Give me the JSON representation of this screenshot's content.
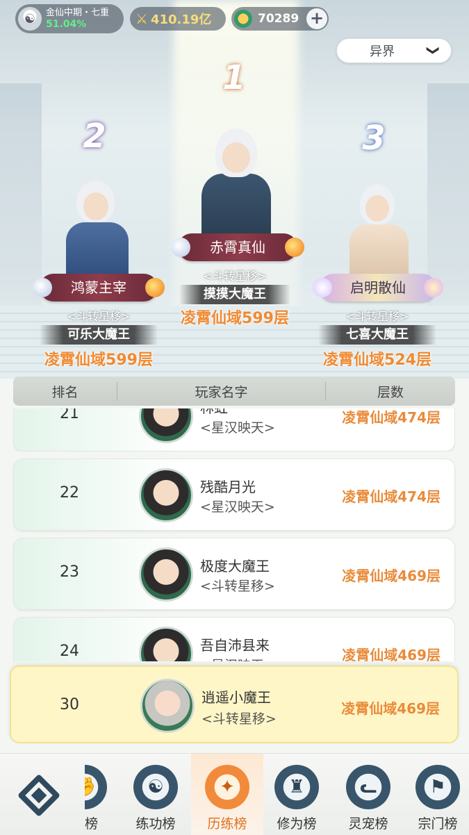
{
  "status": {
    "realm": "金仙中期・七重",
    "progress": "51.04%",
    "power": "410.19亿",
    "currency": "70289",
    "plus": "+"
  },
  "realm_select": {
    "value": "异界",
    "chevron": "❯"
  },
  "podium": [
    {
      "rank": "1",
      "name": "赤霄真仙",
      "sect": "<斗转星移>",
      "leader": "摸摸大魔王",
      "floor": "凌霄仙域599层"
    },
    {
      "rank": "2",
      "name": "鸿蒙主宰",
      "sect": "<斗转星移>",
      "leader": "可乐大魔王",
      "floor": "凌霄仙域599层"
    },
    {
      "rank": "3",
      "name": "启明散仙",
      "sect": "<斗转星移>",
      "leader": "七喜大魔王",
      "floor": "凌霄仙域524层"
    }
  ],
  "table_header": {
    "rank": "排名",
    "player": "玩家名字",
    "floor": "层数"
  },
  "rows": [
    {
      "rank": "21",
      "name": "林虹",
      "sect": "<星汉映天>",
      "floor": "凌霄仙域474层"
    },
    {
      "rank": "22",
      "name": "残酷月光",
      "sect": "<星汉映天>",
      "floor": "凌霄仙域474层"
    },
    {
      "rank": "23",
      "name": "极度大魔王",
      "sect": "<斗转星移>",
      "floor": "凌霄仙域469层"
    },
    {
      "rank": "24",
      "name": "吾自沛县来",
      "sect": "<星汉映天>",
      "floor": "凌霄仙域469层"
    }
  ],
  "self_row": {
    "rank": "30",
    "name": "逍遥小魔王",
    "sect": "<斗转星移>",
    "floor": "凌霄仙域469层"
  },
  "nav": {
    "tabs": [
      {
        "label": "力榜",
        "icon": "fist-icon"
      },
      {
        "label": "练功榜",
        "icon": "yin-yang-icon"
      },
      {
        "label": "历练榜",
        "icon": "sparkle-icon"
      },
      {
        "label": "修为榜",
        "icon": "hat-icon"
      },
      {
        "label": "灵宠榜",
        "icon": "pet-icon"
      },
      {
        "label": "宗门榜",
        "icon": "flag-icon"
      }
    ],
    "active_index": 2
  },
  "colors": {
    "accent_orange": "#e98b3a",
    "self_highlight": "#fff6c8"
  }
}
